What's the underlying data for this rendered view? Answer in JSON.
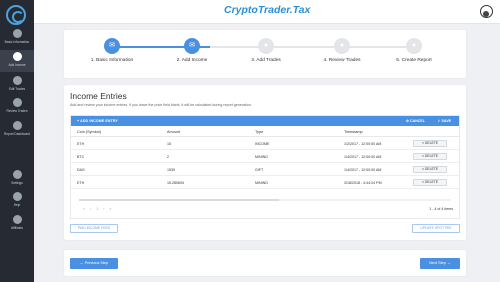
{
  "brand": {
    "name": "CryptoTrader.Tax"
  },
  "sidebar": {
    "items": [
      {
        "label": "Basic Information",
        "icon": "layers-icon",
        "active": false
      },
      {
        "label": "Add Income",
        "icon": "income-icon",
        "active": true
      },
      {
        "label": "Edit Trades",
        "icon": "trades-icon",
        "active": false
      },
      {
        "label": "Review Trades",
        "icon": "review-icon",
        "active": false
      },
      {
        "label": "Report Dashboard",
        "icon": "report-icon",
        "active": false
      },
      {
        "label": "Settings",
        "icon": "gear-icon",
        "active": false
      },
      {
        "label": "Help",
        "icon": "help-icon",
        "active": false
      },
      {
        "label": "Affiliates",
        "icon": "hand-icon",
        "active": false
      }
    ]
  },
  "stepper": {
    "steps": [
      {
        "label": "1. Basic Information",
        "done": true
      },
      {
        "label": "2. Add Income",
        "done": true
      },
      {
        "label": "3. Add Trades",
        "done": false
      },
      {
        "label": "4. Review Trades",
        "done": false
      },
      {
        "label": "5. Create Report",
        "done": false
      }
    ]
  },
  "income": {
    "title": "Income Entries",
    "description": "Add and review your income entries. If you leave the price field blank, it will be calculated during report generation.",
    "toolbar": {
      "add": "+ ADD INCOME ENTRY",
      "cancel": "⊘ CANCEL",
      "save": "✓ SAVE"
    },
    "columns": [
      "Coin (Symbol)",
      "Amount",
      "Type",
      "Timestamp"
    ],
    "rows": [
      {
        "coin": "ETH",
        "amount": "15",
        "type": "INCOME",
        "timestamp": "1/2/2017 - 12:00:00 AM",
        "delete": "× DELETE"
      },
      {
        "coin": "BTC",
        "amount": "2",
        "type": "MINING",
        "timestamp": "1/4/2017 - 12:00:00 AM",
        "delete": "× DELETE"
      },
      {
        "coin": "DAG",
        "amount": "1539",
        "type": "GIFT",
        "timestamp": "1/4/2017 - 12:00:00 AM",
        "delete": "× DELETE"
      },
      {
        "coin": "ETH",
        "amount": "15.280694",
        "type": "MINING",
        "timestamp": "3/18/2018 - 4:44:24 PM",
        "delete": "× DELETE"
      }
    ],
    "pager": "« ‹ 1 › »",
    "count": "1 - 4 of 4 items",
    "buttons": {
      "left": "PAID INCOME FEES",
      "right": "UPDATE SPOT FEE"
    }
  },
  "nav": {
    "previous": "← Previous Step",
    "next": "Next Step →"
  },
  "colors": {
    "accent": "#4a90e2",
    "sidebar": "#262b33"
  }
}
